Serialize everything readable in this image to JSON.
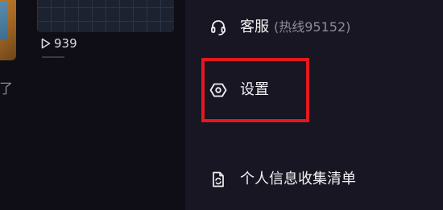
{
  "background": {
    "view_count": "939",
    "text_fragment": "了"
  },
  "menu": {
    "items": [
      {
        "label": "客服",
        "sublabel": "(热线95152)",
        "icon": "headset-icon"
      },
      {
        "label": "设置",
        "icon": "hexagon-settings-icon"
      },
      {
        "label": "个人信息收集清单",
        "icon": "document-sync-icon"
      }
    ]
  },
  "colors": {
    "menu_background": "#171622",
    "text": "#f1f1f4",
    "muted_text": "#8d8c98",
    "highlight": "#e2191f"
  }
}
